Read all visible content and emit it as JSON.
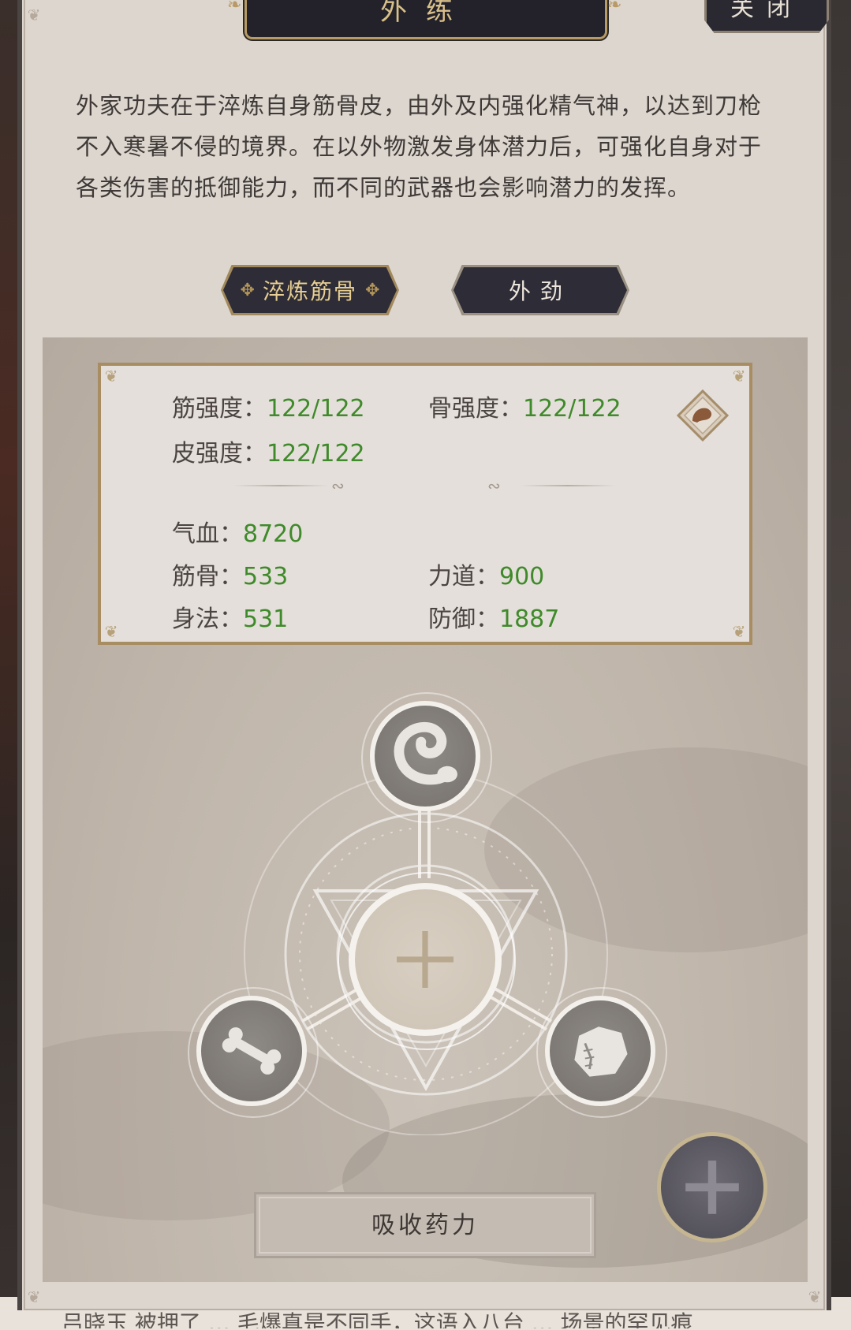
{
  "window": {
    "title": "外练",
    "close_label": "关闭"
  },
  "description": "外家功夫在于淬炼自身筋骨皮，由外及内强化精气神，以达到刀枪不入寒暑不侵的境界。在以外物激发身体潜力后，可强化自身对于各类伤害的抵御能力，而不同的武器也会影响潜力的发挥。",
  "tabs": [
    {
      "label": "淬炼筋骨",
      "active": true
    },
    {
      "label": "外劲",
      "active": false
    }
  ],
  "stats": {
    "tendon_strength": {
      "label": "筋强度：",
      "value": "122/122"
    },
    "bone_strength": {
      "label": "骨强度：",
      "value": "122/122"
    },
    "skin_strength": {
      "label": "皮强度：",
      "value": "122/122"
    },
    "hp": {
      "label": "气血：",
      "value": "8720"
    },
    "physique": {
      "label": "筋骨：",
      "value": "533"
    },
    "strength": {
      "label": "力道：",
      "value": "900"
    },
    "agility": {
      "label": "身法：",
      "value": "531"
    },
    "defense": {
      "label": "防御：",
      "value": "1887"
    }
  },
  "nodes": {
    "top_icon": "tendon-icon",
    "left_icon": "bone-icon",
    "right_icon": "skin-icon",
    "center_icon": "plus-icon"
  },
  "actions": {
    "absorb_label": "吸收药力"
  },
  "background_text": "吕晓玉 被押了 … 毛爆真是不同手，这语入八台 … 场景的罕见痕"
}
